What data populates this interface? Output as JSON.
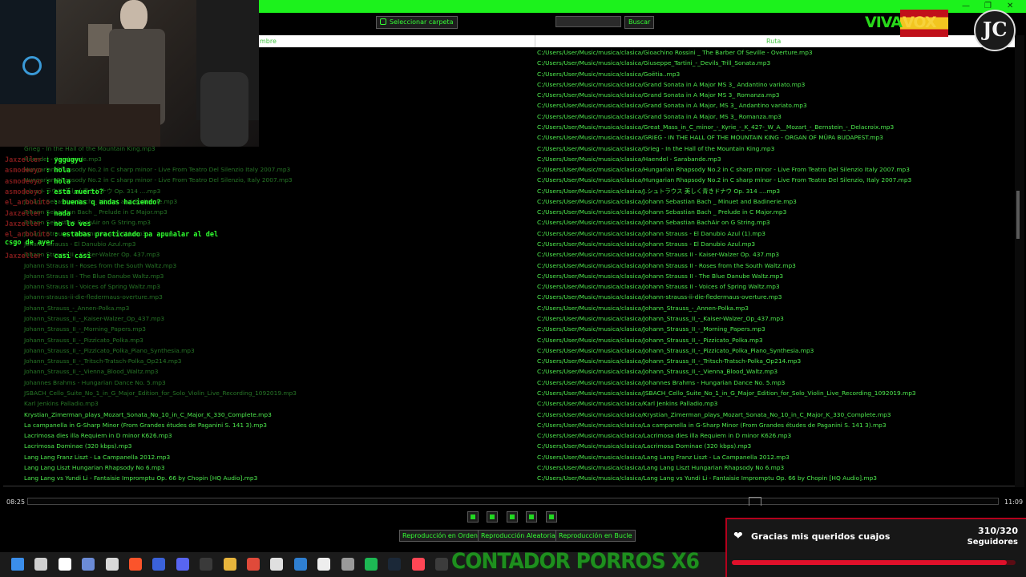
{
  "window": {
    "controls": [
      "—",
      "❐",
      "✕"
    ]
  },
  "toolbar": {
    "folder_button": "Seleccionar carpeta",
    "search_placeholder": "",
    "search_button": "Buscar"
  },
  "table": {
    "headers": {
      "name": "mbre",
      "path": "Ruta"
    },
    "rows": [
      {
        "name": "",
        "path": "C:/Users/User/Music/musica/clasica/Gioachino Rossini _ The Barber Of Seville - Overture.mp3",
        "dim": true
      },
      {
        "name": "",
        "path": "C:/Users/User/Music/musica/clasica/Giuseppe_Tartini_-_Devils_Trill_Sonata.mp3",
        "dim": true
      },
      {
        "name": "",
        "path": "C:/Users/User/Music/musica/clasica/Goëtia..mp3",
        "dim": true
      },
      {
        "name": "",
        "path": "C:/Users/User/Music/musica/clasica/Grand Sonata in A Major MS 3_ Andantino variato.mp3",
        "dim": true
      },
      {
        "name": "",
        "path": "C:/Users/User/Music/musica/clasica/Grand Sonata in A Major MS 3_ Romanza.mp3",
        "dim": true
      },
      {
        "name": "",
        "path": "C:/Users/User/Music/musica/clasica/Grand Sonata in A Major, MS 3_ Andantino variato.mp3",
        "dim": true
      },
      {
        "name": "",
        "path": "C:/Users/User/Music/musica/clasica/Grand Sonata in A Major, MS 3_ Romanza.mp3",
        "dim": true
      },
      {
        "name": "",
        "path": "C:/Users/User/Music/musica/clasica/Great_Mass_in_C_minor_-_Kyrie_-_K_427-_W_A__Mozart_-_Bernstein_-_Delacroix.mp3",
        "dim": true
      },
      {
        "name": "",
        "path": "C:/Users/User/Music/musica/clasica/GRIEG - IN THE HALL OF THE MOUNTAIN KING - ORGAN OF MÜPA BUDAPEST.mp3",
        "dim": true
      },
      {
        "name": "Grieg - In the Hall of the Mountain King.mp3",
        "path": "C:/Users/User/Music/musica/clasica/Grieg - In the Hall of the Mountain King.mp3",
        "dim": true
      },
      {
        "name": "Haendel - Sarabande.mp3",
        "path": "C:/Users/User/Music/musica/clasica/Haendel - Sarabande.mp3",
        "dim": true
      },
      {
        "name": "Hungarian Rhapsody No.2 in C sharp minor - Live From Teatro Del Silenzio Italy 2007.mp3",
        "path": "C:/Users/User/Music/musica/clasica/Hungarian Rhapsody No.2 in C sharp minor - Live From Teatro Del Silenzio Italy 2007.mp3",
        "dim": true
      },
      {
        "name": "Hungarian Rhapsody No.2 in C sharp minor - Live From Teatro Del Silenzio, Italy 2007.mp3",
        "path": "C:/Users/User/Music/musica/clasica/Hungarian Rhapsody No.2 in C sharp minor - Live From Teatro Del Silenzio, Italy 2007.mp3",
        "dim": true
      },
      {
        "name": "J.シュトラウス 美しく青きドナウ Op. 314 ....mp3",
        "path": "C:/Users/User/Music/musica/clasica/J.シュトラウス 美しく青きドナウ Op. 314 ....mp3",
        "dim": true
      },
      {
        "name": "Johann Sebastian Bach _ Minuet and Badinerie.mp3",
        "path": "C:/Users/User/Music/musica/clasica/Johann Sebastian Bach _ Minuet and Badinerie.mp3",
        "dim": true
      },
      {
        "name": "Johann Sebastian Bach _ Prelude in C Major.mp3",
        "path": "C:/Users/User/Music/musica/clasica/Johann Sebastian Bach _ Prelude in C Major.mp3",
        "dim": true
      },
      {
        "name": "Johann Sebastian BachAir on G String.mp3",
        "path": "C:/Users/User/Music/musica/clasica/Johann Sebastian BachAir on G String.mp3",
        "dim": true
      },
      {
        "name": "Johann Strauss - El Danubio Azul (1).mp3",
        "path": "C:/Users/User/Music/musica/clasica/Johann Strauss - El Danubio Azul (1).mp3",
        "dim": true
      },
      {
        "name": "Johann Strauss - El Danubio Azul.mp3",
        "path": "C:/Users/User/Music/musica/clasica/Johann Strauss - El Danubio Azul.mp3",
        "dim": true
      },
      {
        "name": "Johann Strauss II - Kaiser-Walzer Op. 437.mp3",
        "path": "C:/Users/User/Music/musica/clasica/Johann Strauss II - Kaiser-Walzer Op. 437.mp3",
        "dim": true
      },
      {
        "name": "Johann Strauss II - Roses from the South Waltz.mp3",
        "path": "C:/Users/User/Music/musica/clasica/Johann Strauss II - Roses from the South Waltz.mp3",
        "dim": true
      },
      {
        "name": "Johann Strauss II - The Blue Danube Waltz.mp3",
        "path": "C:/Users/User/Music/musica/clasica/Johann Strauss II - The Blue Danube Waltz.mp3",
        "dim": true
      },
      {
        "name": "Johann Strauss II - Voices of Spring Waltz.mp3",
        "path": "C:/Users/User/Music/musica/clasica/Johann Strauss II - Voices of Spring Waltz.mp3",
        "dim": true
      },
      {
        "name": "johann-strauss-ii-die-fledermaus-overture.mp3",
        "path": "C:/Users/User/Music/musica/clasica/johann-strauss-ii-die-fledermaus-overture.mp3",
        "dim": true
      },
      {
        "name": "Johann_Strauss_-_Annen-Polka.mp3",
        "path": "C:/Users/User/Music/musica/clasica/Johann_Strauss_-_Annen-Polka.mp3",
        "dim": true
      },
      {
        "name": "Johann_Strauss_II_-_Kaiser-Walzer_Op_437.mp3",
        "path": "C:/Users/User/Music/musica/clasica/Johann_Strauss_II_-_Kaiser-Walzer_Op_437.mp3",
        "dim": true
      },
      {
        "name": "Johann_Strauss_II_-_Morning_Papers.mp3",
        "path": "C:/Users/User/Music/musica/clasica/Johann_Strauss_II_-_Morning_Papers.mp3",
        "dim": true
      },
      {
        "name": "Johann_Strauss_II_-_Pizzicato_Polka.mp3",
        "path": "C:/Users/User/Music/musica/clasica/Johann_Strauss_II_-_Pizzicato_Polka.mp3",
        "dim": true
      },
      {
        "name": "Johann_Strauss_II_-_Pizzicato_Polka_Piano_Synthesia.mp3",
        "path": "C:/Users/User/Music/musica/clasica/Johann_Strauss_II_-_Pizzicato_Polka_Piano_Synthesia.mp3",
        "dim": true
      },
      {
        "name": "Johann_Strauss_II_-_Tritsch-Tratsch-Polka_Op214.mp3",
        "path": "C:/Users/User/Music/musica/clasica/Johann_Strauss_II_-_Tritsch-Tratsch-Polka_Op214.mp3",
        "dim": true
      },
      {
        "name": "Johann_Strauss_II_-_Vienna_Blood_Waltz.mp3",
        "path": "C:/Users/User/Music/musica/clasica/Johann_Strauss_II_-_Vienna_Blood_Waltz.mp3",
        "dim": true
      },
      {
        "name": "Johannes Brahms - Hungarian Dance No. 5.mp3",
        "path": "C:/Users/User/Music/musica/clasica/Johannes Brahms - Hungarian Dance No. 5.mp3",
        "dim": true
      },
      {
        "name": "JSBACH_Cello_Suite_No_1_in_G_Major_Edition_for_Solo_Violin_Live_Recording_1092019.mp3",
        "path": "C:/Users/User/Music/musica/clasica/JSBACH_Cello_Suite_No_1_in_G_Major_Edition_for_Solo_Violin_Live_Recording_1092019.mp3",
        "dim": true
      },
      {
        "name": "Karl Jenkins Palladio.mp3",
        "path": "C:/Users/User/Music/musica/clasica/Karl Jenkins Palladio.mp3",
        "dim": true
      },
      {
        "name": "Krystian_Zimerman_plays_Mozart_Sonata_No_10_in_C_Major_K_330_Complete.mp3",
        "path": "C:/Users/User/Music/musica/clasica/Krystian_Zimerman_plays_Mozart_Sonata_No_10_in_C_Major_K_330_Complete.mp3",
        "dim": false
      },
      {
        "name": "La campanella in G-Sharp Minor (From Grandes études de Paganini S. 141 3).mp3",
        "path": "C:/Users/User/Music/musica/clasica/La campanella in G-Sharp Minor (From Grandes études de Paganini S. 141 3).mp3",
        "dim": false
      },
      {
        "name": "Lacrimosa dies illa Requiem in D minor K626.mp3",
        "path": "C:/Users/User/Music/musica/clasica/Lacrimosa dies illa Requiem in D minor K626.mp3",
        "dim": false
      },
      {
        "name": "Lacrimosa Dominae (320 kbps).mp3",
        "path": "C:/Users/User/Music/musica/clasica/Lacrimosa Dominae (320 kbps).mp3",
        "dim": false
      },
      {
        "name": "Lang Lang Franz Liszt - La Campanella 2012.mp3",
        "path": "C:/Users/User/Music/musica/clasica/Lang Lang Franz Liszt - La Campanella 2012.mp3",
        "dim": false
      },
      {
        "name": "Lang Lang Liszt Hungarian Rhapsody No 6.mp3",
        "path": "C:/Users/User/Music/musica/clasica/Lang Lang Liszt Hungarian Rhapsody No 6.mp3",
        "dim": false
      },
      {
        "name": "Lang Lang vs Yundi Li - Fantaisie Impromptu Op. 66 by Chopin [HQ Audio].mp3",
        "path": "C:/Users/User/Music/musica/clasica/Lang Lang vs Yundi Li - Fantaisie Impromptu Op. 66 by Chopin [HQ Audio].mp3",
        "dim": false
      }
    ]
  },
  "player": {
    "elapsed": "08:25",
    "total": "11:09",
    "progress_fraction": 0.755,
    "controls": [
      "previous-icon",
      "play-icon",
      "pause-icon",
      "stop-icon",
      "next-icon"
    ],
    "modes": [
      "Reproducción en Orden",
      "Reproducción Aleatoria",
      "Reproducción en Bucle"
    ]
  },
  "chat": [
    {
      "user": "Jaxzeller",
      "message": "yggugyu"
    },
    {
      "user": "asmodeoyo",
      "message": "hola"
    },
    {
      "user": "asmodeoyo",
      "message": "hola"
    },
    {
      "user": "asmodeoyo",
      "message": "está muerto?"
    },
    {
      "user": "el_arbolito",
      "message": "buenas q andas haciendo?"
    },
    {
      "user": "Jaxzeller",
      "message": "nada"
    },
    {
      "user": "Jaxzeller",
      "message": "no lo ves"
    },
    {
      "user": "el_arbolito",
      "message": "estabas practicando pa apuñalar al del csgo de ayer"
    },
    {
      "user": "Jaxzeller",
      "message": "casi casi"
    }
  ],
  "overlay": {
    "brand_viva": "VIVA",
    "brand_vox": "VOX",
    "logo": "JC",
    "counter": "CONTADOR PORROS X6",
    "followers_text": "Gracias mis queridos cuajos",
    "followers_count": "310/320",
    "followers_label": "Seguidores",
    "followers_fraction": 0.969
  },
  "taskbar": {
    "icons": [
      "windows-icon",
      "search-icon",
      "app-icon",
      "visual-studio-icon",
      "files-icon",
      "brave-icon",
      "v-icon",
      "discord-icon",
      "obs-icon",
      "folder-icon",
      "chrome-icon",
      "cube-icon",
      "vscode-icon",
      "terminal-icon",
      "gear-icon",
      "spotify-icon",
      "steam-icon",
      "valorant-icon",
      "cmd-icon"
    ]
  },
  "colors": {
    "accent": "#1cf21c",
    "text": "#4eea4e",
    "follower_red": "#e0102a"
  }
}
